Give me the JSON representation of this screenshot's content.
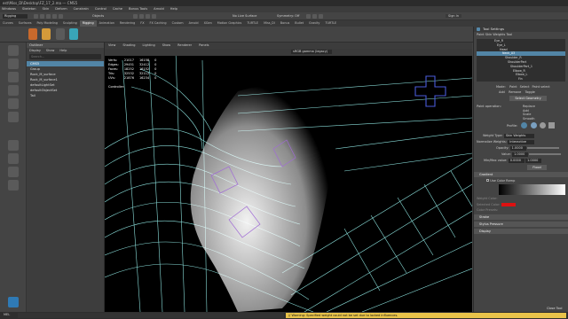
{
  "window": {
    "title": "est\\Miss_DI\\Desktop\\FZ_17_2.ma  ---  CMS5"
  },
  "menus": [
    "Windows",
    "Skeleton",
    "Skin",
    "Deform",
    "Constrain",
    "Control",
    "Cache",
    "Bonus Tools",
    "Arnold",
    "Help"
  ],
  "status": {
    "workspace": "Rigging",
    "objects_label": "Objects",
    "live_surface": "No Live Surface",
    "symmetry": "Symmetry: Off",
    "sign_in": "Sign In"
  },
  "shelf_tabs": [
    "Curves",
    "Surfaces",
    "Poly Modeling",
    "Sculpting",
    "Rigging",
    "Animation",
    "Rendering",
    "FX",
    "FX Caching",
    "Custom",
    "Arnold",
    "XGen",
    "Motion Graphics",
    "TURTLE",
    "Miss_DI",
    "Bonus",
    "Bullet",
    "Gravity",
    "TURTLE"
  ],
  "outliner": {
    "title": "Outliner",
    "menus": [
      "Display",
      "Show",
      "Help"
    ],
    "search_placeholder": "Search...",
    "items": [
      {
        "label": "CMS5",
        "selected": true
      },
      {
        "label": "Group",
        "selected": false
      },
      {
        "label": "Rock_M_surface",
        "selected": false
      },
      {
        "label": "Rock_M_surface1",
        "selected": false
      },
      {
        "label": "defaultLightSet",
        "selected": false
      },
      {
        "label": "defaultObjectSet",
        "selected": false
      },
      {
        "label": "Tail",
        "selected": false
      }
    ]
  },
  "viewport": {
    "menus": [
      "View",
      "Shading",
      "Lighting",
      "Show",
      "Renderer",
      "Panels"
    ],
    "hud": {
      "rows": [
        {
          "name": "Verts:",
          "a": "21017",
          "b": "16158",
          "c": "0"
        },
        {
          "name": "Edges:",
          "a": "29451",
          "b": "32412",
          "c": "0"
        },
        {
          "name": "Faces:",
          "a": "18252",
          "b": "16152",
          "c": "0"
        },
        {
          "name": "Tris:",
          "a": "32532",
          "b": "32112",
          "c": "0"
        },
        {
          "name": "UVs:",
          "a": "21876",
          "b": "16234",
          "c": "0"
        }
      ],
      "controller_label": "Controller:"
    },
    "color_mgmt": "sRGB gamma (legacy)"
  },
  "tool_settings": {
    "window_title": "Tool Settings",
    "tool_name": "Paint Skin Weights Tool",
    "influences": [
      "Eye_R",
      "Eye_L",
      "Head",
      "Neck_03",
      "Shoulder_R",
      "ShoulderPart",
      "ShoulderPart_1",
      "Elbow_R",
      "Elbow_L",
      "Fin"
    ],
    "selected_influence": 3,
    "mode_label": "Mode:",
    "mode_options": [
      "Paint",
      "Select",
      "Paint select"
    ],
    "add_label": "Add",
    "remove_label": "Remove",
    "toggle_label": "Toggle",
    "select_geometry": "Select Geometry",
    "paint_operation_label": "Paint operation:",
    "paint_ops": [
      "Replace",
      "Add",
      "Scale",
      "Smooth"
    ],
    "profile_label": "Profile:",
    "weight_type_label": "Weight Type:",
    "weight_type": "Skin Weights",
    "normalize_label": "Normalize Weights:",
    "normalize": "Interactive",
    "opacity_label": "Opacity:",
    "opacity": "1.0000",
    "value_label": "Value:",
    "value": "1.0000",
    "minmax_label": "Min/Max value:",
    "min": "0.0000",
    "max": "1.0000",
    "flood": "Flood",
    "gradient_label": "Gradient",
    "use_color_ramp": "Use Color Ramp",
    "weight_color_label": "Weight Color:",
    "selected_color_label": "Selected Color:",
    "color_preset_label": "Color Presets:",
    "sections": [
      "Stroke",
      "Stylus Pressure",
      "Display"
    ],
    "close_label": "Close Tool",
    "accent": "#5285a6"
  },
  "help_line": {
    "mel": "MEL",
    "warning": "// Warning: Specified weight could not be set due to locked influences."
  }
}
